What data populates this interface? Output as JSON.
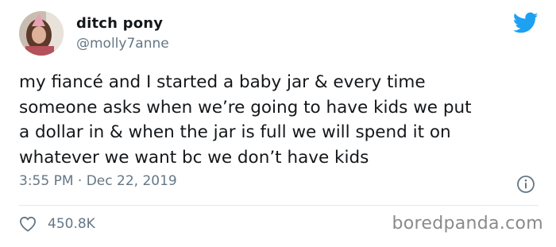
{
  "user": {
    "display_name": "ditch pony",
    "handle": "@molly7anne"
  },
  "tweet": {
    "text": "my fiancé and I started a baby jar & every time\nsomeone asks when we’re going to have kids we put\na dollar in & when the jar is full we will spend it on\nwhatever we want bc we don’t have kids",
    "timestamp": "3:55 PM · Dec 22, 2019",
    "likes": "450.8K"
  },
  "watermark": "boredpanda.com",
  "colors": {
    "text": "#14171a",
    "secondary": "#657786",
    "twitter_blue": "#1da1f2",
    "divider": "#e1e8ed"
  },
  "icons": [
    "avatar",
    "twitter-bird-icon",
    "info-icon",
    "heart-icon"
  ]
}
